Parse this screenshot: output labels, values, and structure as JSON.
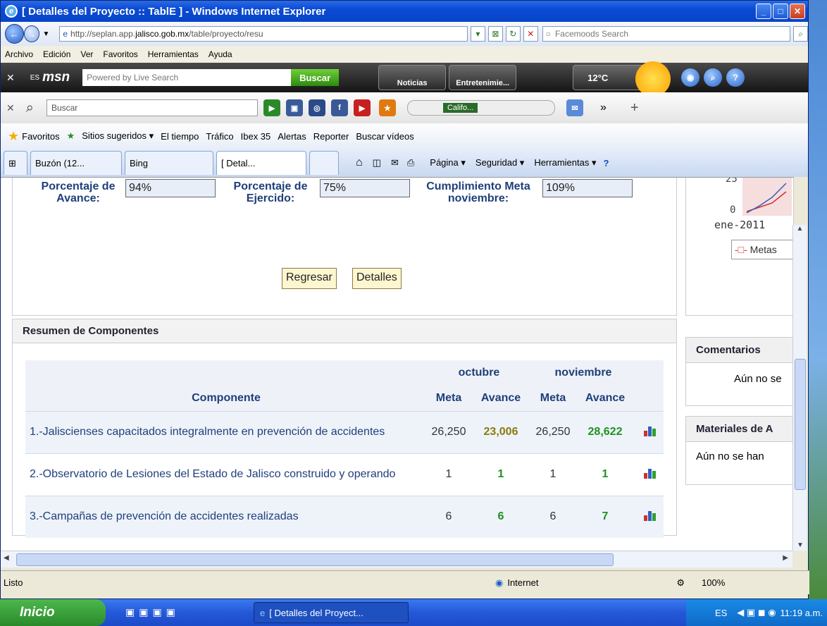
{
  "window": {
    "title": "[ Detalles del Proyecto :: TablE ] - Windows Internet Explorer"
  },
  "addressbar": {
    "url_prefix": "http://seplan.app.",
    "url_domain": "jalisco.gob.mx",
    "url_rest": "/table/proyecto/resu",
    "search_placeholder": "Facemoods Search"
  },
  "menubar": [
    "Archivo",
    "Edición",
    "Ver",
    "Favoritos",
    "Herramientas",
    "Ayuda"
  ],
  "msn": {
    "locale": "ES",
    "logo": "msn",
    "search_placeholder": "Powered by Live Search",
    "search_button": "Buscar",
    "tab_news": "Noticias",
    "tab_ent": "Entretenimie...",
    "temp": "12°C"
  },
  "toolbar2": {
    "search_placeholder": "Buscar",
    "radio": "Califo..."
  },
  "favbar": {
    "favorites": "Favoritos",
    "items": [
      "Sitios sugeridos ▾",
      "El tiempo",
      "Tráfico",
      "Ibex 35",
      "Alertas",
      "Reporter",
      "Buscar vídeos"
    ]
  },
  "tabs": [
    "Buzón (12...",
    "Bing",
    "[ Detal..."
  ],
  "commands": [
    "Página ▾",
    "Seguridad ▾",
    "Herramientas ▾"
  ],
  "project": {
    "avance_label": "Porcentaje de Avance:",
    "avance_value": "94%",
    "ejercido_label": "Porcentaje de Ejercido:",
    "ejercido_value": "75%",
    "cumplimiento_label": "Cumplimiento Meta noviembre:",
    "cumplimiento_value": "109%",
    "btn_back": "Regresar",
    "btn_details": "Detalles"
  },
  "summary": {
    "title": "Resumen de Componentes",
    "month1": "octubre",
    "month2": "noviembre",
    "col_componente": "Componente",
    "col_meta": "Meta",
    "col_avance": "Avance",
    "rows": [
      {
        "name": "1.-Jaliscienses capacitados integralmente en prevención de accidentes",
        "oct_meta": "26,250",
        "oct_avance": "23,006",
        "nov_meta": "26,250",
        "nov_avance": "28,622"
      },
      {
        "name": "2.-Observatorio de Lesiones del Estado de Jalisco construido y operando",
        "oct_meta": "1",
        "oct_avance": "1",
        "nov_meta": "1",
        "nov_avance": "1"
      },
      {
        "name": "3.-Campañas de prevención de accidentes realizadas",
        "oct_meta": "6",
        "oct_avance": "6",
        "nov_meta": "6",
        "nov_avance": "7"
      }
    ]
  },
  "sidebar": {
    "chart_y25": "25",
    "chart_y0": "0",
    "chart_x": "ene-2011",
    "legend": "Metas",
    "comentarios_title": "Comentarios",
    "comentarios_text": "Aún no se",
    "materiales_title": "Materiales de A",
    "materiales_text": "Aún no se han"
  },
  "status": {
    "text": "Listo",
    "zone": "Internet",
    "zoom": "100%"
  },
  "taskbar": {
    "start": "Inicio",
    "task": "[ Detalles del Proyect...",
    "lang": "ES",
    "clock": "11:19 a.m."
  }
}
